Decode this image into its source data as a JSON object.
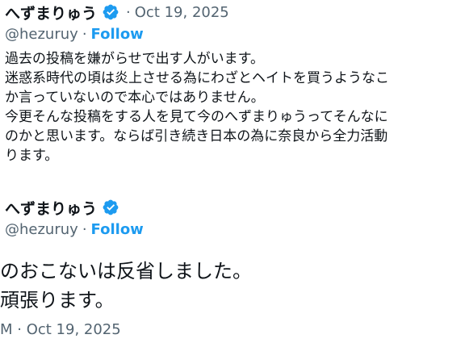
{
  "post_one": {
    "display_name": "へずまりゅう",
    "dot": "·",
    "timestamp": "Oct 19, 2025",
    "handle": "@hezuruy",
    "separator": "·",
    "follow_label": "Follow",
    "lines": [
      "過去の投稿を嫌がらせで出す人がいます。",
      "迷惑系時代の頃は炎上させる為にわざとヘイトを買うようなこ",
      "か言っていないので本心ではありません。",
      "今更そんな投稿をする人を見て今のへずまりゅうってそんなに",
      "のかと思います。ならば引き続き日本の為に奈良から全力活動",
      "ります。"
    ]
  },
  "post_two": {
    "display_name": "へずまりゅう",
    "handle": "@hezuruy",
    "separator": "·",
    "follow_label": "Follow",
    "lines": [
      "のおこないは反省しました。",
      "頑張ります。"
    ],
    "footer": "M · Oct 19, 2025"
  },
  "colors": {
    "text": "#0f1419",
    "secondary": "#536471",
    "accent": "#1d9bf0"
  },
  "icons": {
    "verified": "verified-badge-icon"
  }
}
